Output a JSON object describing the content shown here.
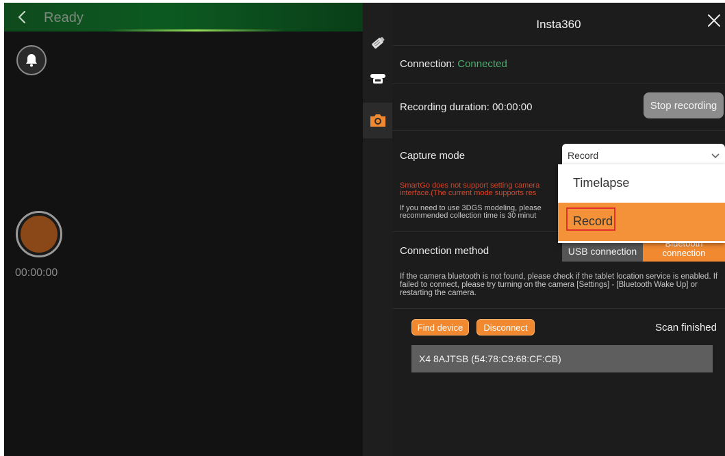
{
  "header": {
    "title": "Ready"
  },
  "camera": {
    "timer": "00:00:00"
  },
  "panel": {
    "title": "Insta360",
    "connection": {
      "label": "Connection:",
      "value": "Connected"
    },
    "recording": {
      "label": "Recording duration: 00:00:00",
      "stop_label": "Stop recording"
    },
    "capture": {
      "label": "Capture mode",
      "selected": "Record",
      "options": [
        "Timelapse",
        "Record"
      ],
      "warning": "SmartGo does not support setting camera interface.(The current mode supports res",
      "note": "If you need to use 3DGS modeling, please recommended collection time is 30 minut"
    },
    "method": {
      "label": "Connection method",
      "usb": "USB connection",
      "bluetooth": "Bluetooth connection"
    },
    "help": "If the camera bluetooth is not found, please check if the tablet location service is enabled. If failed to connect, please try turning on the camera [Settings] - [Bluetooth Wake Up] or restarting the camera.",
    "actions": {
      "find": "Find device",
      "disconnect": "Disconnect",
      "status": "Scan finished"
    },
    "device": "X4 8AJTSB (54:78:C9:68:CF:CB)"
  },
  "colors": {
    "accent": "#f0892f",
    "connected": "#4caf70",
    "warning": "#d9442a"
  },
  "icons": [
    "back-icon",
    "bell-icon",
    "record-icon",
    "gps-antenna-icon",
    "rtk-receiver-icon",
    "camera-icon",
    "close-icon",
    "chevron-down-icon"
  ]
}
